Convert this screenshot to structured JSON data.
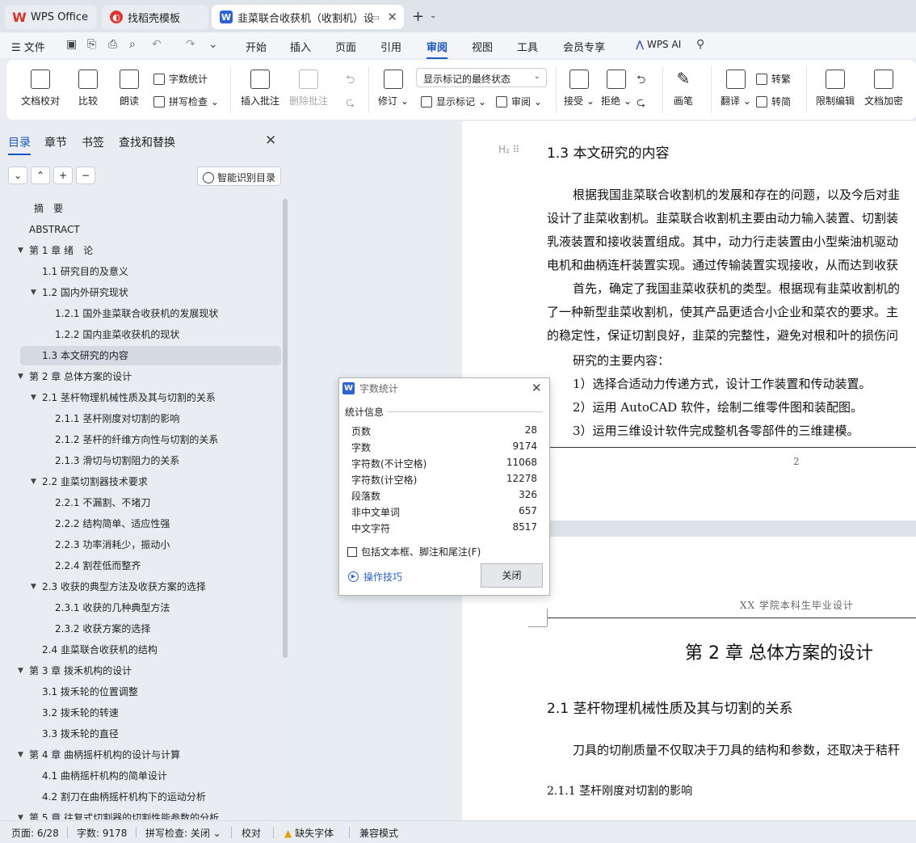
{
  "tabs": {
    "wps": "WPS Office",
    "template": "找稻壳模板",
    "doc": "韭菜联合收获机（收割机）设"
  },
  "menu": {
    "file": "文件",
    "items": [
      "开始",
      "插入",
      "页面",
      "引用",
      "审阅",
      "视图",
      "工具",
      "会员专享"
    ],
    "active": "审阅",
    "wps_ai": "WPS AI"
  },
  "ribbon": {
    "doc_check": "文档校对",
    "compare": "比较",
    "read_aloud": "朗读",
    "word_count": "字数统计",
    "spell_check": "拼写检查",
    "insert_comment": "插入批注",
    "delete_comment": "删除批注",
    "revise": "修订",
    "markup_state": "显示标记的最终状态",
    "show_markup": "显示标记",
    "review": "审阅",
    "accept": "接受",
    "reject": "拒绝",
    "pen": "画笔",
    "translate": "翻译",
    "to_simplified": "转繁",
    "to_traditional": "转简",
    "restrict_edit": "限制编辑",
    "doc_encrypt": "文档加密"
  },
  "nav": {
    "tabs": [
      "目录",
      "章节",
      "书签",
      "查找和替换"
    ],
    "smart_toc": "智能识别目录",
    "toc": [
      "摘　要",
      "ABSTRACT",
      "第 1 章  绪　论",
      "1.1  研究目的及意义",
      "1.2  国内外研究现状",
      "1.2.1 国外韭菜联合收获机的发展现状",
      "1.2.2 国内韭菜收获机的现状",
      "1.3  本文研究的内容",
      "第 2 章  总体方案的设计",
      "2.1 茎杆物理机械性质及其与切割的关系",
      "2.1.1 茎杆刚度对切割的影响",
      "2.1.2 茎杆的纤维方向性与切割的关系",
      "2.1.3 滑切与切割阻力的关系",
      "2.2 韭菜切割器技术要求",
      "2.2.1 不漏割、不堵刀",
      "2.2.2 结构简单、适应性强",
      "2.2.3 功率消耗少，振动小",
      "2.2.4 割茬低而整齐",
      "2.3 收获的典型方法及收获方案的选择",
      "2.3.1 收获的几种典型方法",
      "2.3.2 收获方案的选择",
      "2.4 韭菜联合收获机的结构",
      "第 3 章  拨禾机构的设计",
      "3.1 拨禾轮的位置调整",
      "3.2 拨禾轮的转速",
      "3.3  拨禾轮的直径",
      "第 4 章  曲柄摇杆机构的设计与计算",
      "4.1 曲柄摇杆机构的简单设计",
      "4.2 割刀在曲柄摇杆机构下的运动分析",
      "第 5 章  往复式切割器的切割性能参数的分析"
    ]
  },
  "document": {
    "heading_mark": "H₂",
    "section_title": "1.3  本文研究的内容",
    "paragraphs": [
      "根据我国韭菜联合收割机的发展和存在的问题，以及今后对韭",
      "设计了韭菜收割机。韭菜联合收割机主要由动力输入装置、切割装",
      "乳液装置和接收装置组成。其中，动力行走装置由小型柴油机驱动",
      "电机和曲柄连杆装置实现。通过传输装置实现接收，从而达到收获",
      "首先，确定了我国韭菜收获机的类型。根据现有韭菜收割机的",
      "了一种新型韭菜收割机，使其产品更适合小企业和菜农的要求。主",
      "的稳定性，保证切割良好，韭菜的完整性，避免对根和叶的损伤问",
      "研究的主要内容：",
      "1）选择合适动力传递方式，设计工作装置和传动装置。",
      "2）运用 AutoCAD 软件，绘制二维零件图和装配图。",
      "3）运用三维设计软件完成整机各零部件的三维建模。"
    ],
    "page_number": "2",
    "page_header": "XX 学院本科生毕业设计",
    "chapter_title": "第 2 章  总体方案的设计",
    "section2_title": "2.1 茎杆物理机械性质及其与切割的关系",
    "section2_para": "刀具的切削质量不仅取决于刀具的结构和参数，还取决于秸秆",
    "subsection_title": "2.1.1 茎杆刚度对切割的影响"
  },
  "dialog": {
    "title": "字数统计",
    "group": "统计信息",
    "stats": [
      {
        "label": "页数",
        "value": "28"
      },
      {
        "label": "字数",
        "value": "9174"
      },
      {
        "label": "字符数(不计空格)",
        "value": "11068"
      },
      {
        "label": "字符数(计空格)",
        "value": "12278"
      },
      {
        "label": "段落数",
        "value": "326"
      },
      {
        "label": "非中文单词",
        "value": "657"
      },
      {
        "label": "中文字符",
        "value": "8517"
      }
    ],
    "checkbox": "包括文本框、脚注和尾注(F)",
    "tips": "操作技巧",
    "close": "关闭"
  },
  "status": {
    "page": "页面: 6/28",
    "words": "字数: 9178",
    "spell": "拼写检查: 关闭",
    "proof": "校对",
    "missing_font": "缺失字体",
    "compat": "兼容模式"
  }
}
